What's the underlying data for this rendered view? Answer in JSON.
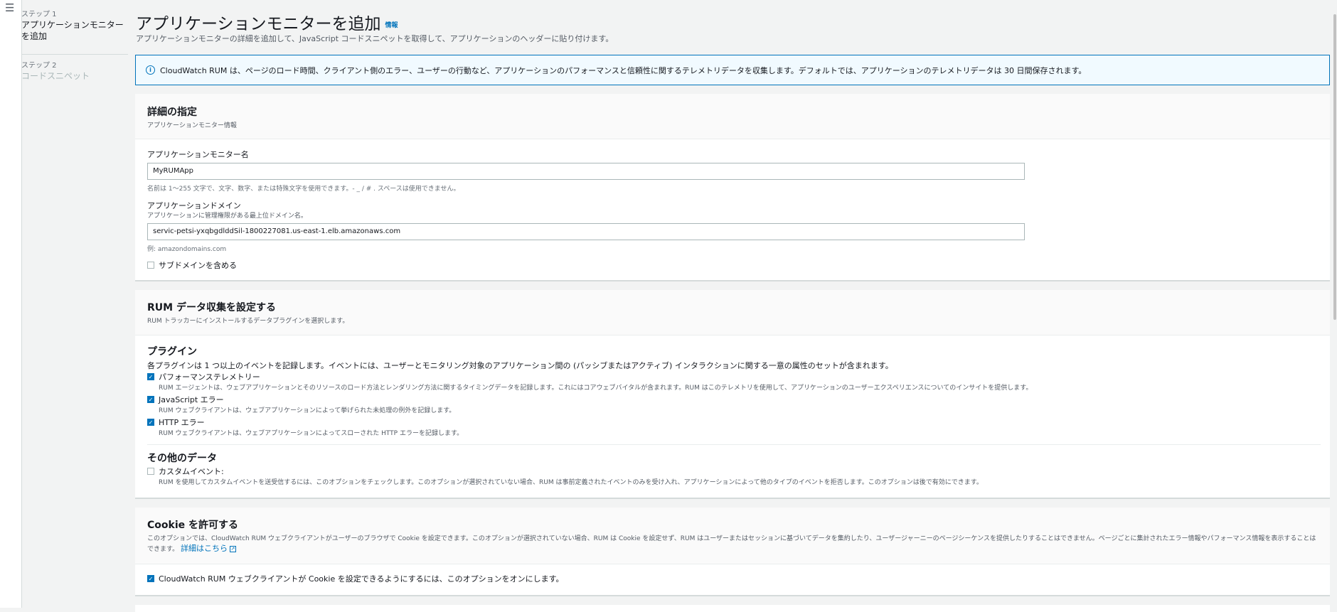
{
  "nav": {
    "menu_icon": "hamburger-menu-icon"
  },
  "steps": [
    {
      "label": "ステップ 1",
      "title": "アプリケーションモニターを追加"
    },
    {
      "label": "ステップ 2",
      "title": "コードスニペット"
    }
  ],
  "header": {
    "title": "アプリケーションモニターを追加",
    "info": "情報",
    "description": "アプリケーションモニターの詳細を追加して、JavaScript コードスニペットを取得して、アプリケーションのヘッダーに貼り付けます。"
  },
  "flash": {
    "icon": "info-circle-icon",
    "text": "CloudWatch RUM は、ページのロード時間、クライアント側のエラー、ユーザーの行動など、アプリケーションのパフォーマンスと信頼性に関するテレメトリデータを収集します。デフォルトでは、アプリケーションのテレメトリデータは 30 日間保存されます。"
  },
  "details": {
    "title": "詳細の指定",
    "subtitle": "アプリケーションモニター情報",
    "name_label": "アプリケーションモニター名",
    "name_value": "MyRUMApp",
    "name_hint": "名前は 1～255 文字で、文字、数字、または特殊文字を使用できます。- _ / # . スペースは使用できません。",
    "domain_label": "アプリケーションドメイン",
    "domain_sub": "アプリケーションに管理権限がある最上位ドメイン名。",
    "domain_value": "servic-petsi-yxqbgdlddSil-1800227081.us-east-1.elb.amazonaws.com",
    "domain_hint": "例: amazondomains.com",
    "subdomain_label": "サブドメインを含める"
  },
  "rum": {
    "title": "RUM データ収集を設定する",
    "subtitle": "RUM トラッカーにインストールするデータプラグインを選択します。",
    "plugins_title": "プラグイン",
    "plugins_desc": "各プラグインは 1 つ以上のイベントを記録します。イベントには、ユーザーとモニタリング対象のアプリケーション間の (パッシブまたはアクティブ) インタラクションに関する一意の属性のセットが含まれます。",
    "plugins": [
      {
        "label": "パフォーマンステレメトリー",
        "desc": "RUM エージェントは、ウェブアプリケーションとそのリソースのロード方法とレンダリング方法に関するタイミングデータを記録します。これにはコアウェブバイタルが含まれます。RUM はこのテレメトリを使用して、アプリケーションのユーザーエクスペリエンスについてのインサイトを提供します。"
      },
      {
        "label": "JavaScript エラー",
        "desc": "RUM ウェブクライアントは、ウェブアプリケーションによって挙げられた未処理の例外を記録します。"
      },
      {
        "label": "HTTP エラー",
        "desc": "RUM ウェブクライアントは、ウェブアプリケーションによってスローされた HTTP エラーを記録します。"
      }
    ],
    "other_title": "その他のデータ",
    "custom_label": "カスタムイベント:",
    "custom_desc": "RUM を使用してカスタムイベントを送受信するには、このオプションをチェックします。このオプションが選択されていない場合、RUM は事前定義されたイベントのみを受け入れ、アプリケーションによって他のタイプのイベントを拒否します。このオプションは後で有効にできます。"
  },
  "cookie": {
    "title": "Cookie を許可する",
    "desc": "このオプションでは、CloudWatch RUM ウェブクライアントがユーザーのブラウザで Cookie を設定できます。このオプションが選択されていない場合、RUM は Cookie を設定せず、RUM はユーザーまたはセッションに基づいてデータを集約したり、ユーザージャーニーのページシーケンスを提供したりすることはできません。ページごとに集計されたエラー情報やパフォーマンス情報を表示することはできます。",
    "learn_more": "詳細はこちら",
    "checkbox_label": "CloudWatch RUM ウェブクライアントが Cookie を設定できるようにするには、このオプションをオンにします。"
  },
  "colors": {
    "accent": "#0073bb",
    "background": "#f2f3f3"
  }
}
